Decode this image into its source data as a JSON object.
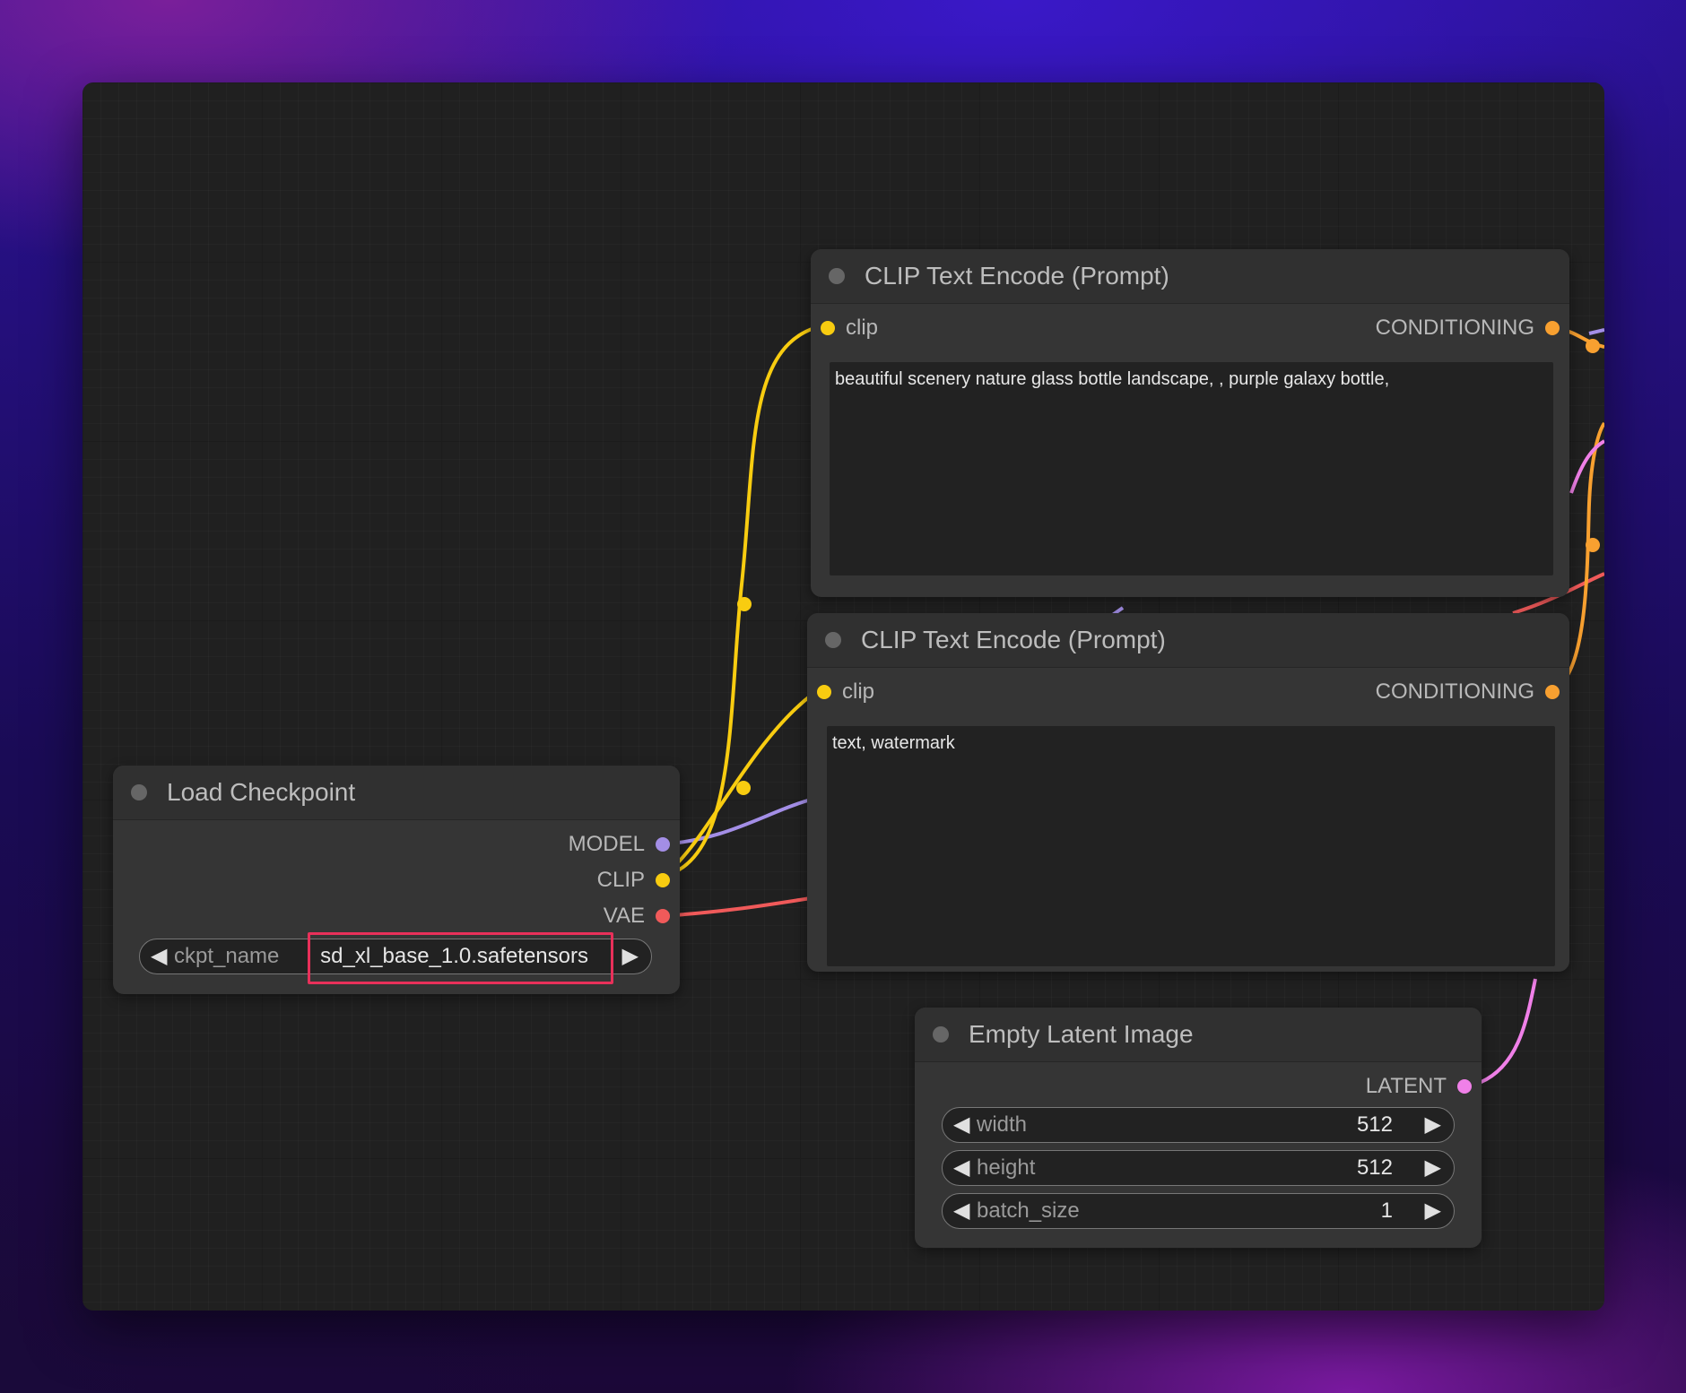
{
  "nodes": {
    "clip_top": {
      "title": "CLIP Text Encode (Prompt)",
      "input_label": "clip",
      "output_label": "CONDITIONING",
      "text": "beautiful scenery nature glass bottle landscape, , purple galaxy bottle,"
    },
    "clip_bottom": {
      "title": "CLIP Text Encode (Prompt)",
      "input_label": "clip",
      "output_label": "CONDITIONING",
      "text": "text, watermark"
    },
    "load_checkpoint": {
      "title": "Load Checkpoint",
      "outputs": [
        "MODEL",
        "CLIP",
        "VAE"
      ],
      "widget": {
        "name": "ckpt_name",
        "value": "sd_xl_base_1.0.safetensors"
      }
    },
    "empty_latent": {
      "title": "Empty Latent Image",
      "output_label": "LATENT",
      "widgets": [
        {
          "name": "width",
          "value": "512"
        },
        {
          "name": "height",
          "value": "512"
        },
        {
          "name": "batch_size",
          "value": "1"
        }
      ]
    }
  },
  "icons": {
    "arrow_left": "◀",
    "arrow_right": "▶"
  },
  "colors": {
    "model": "#a38ee6",
    "clip": "#f8cc10",
    "vae": "#f05a5a",
    "conditioning": "#f8a030",
    "latent": "#f080e8",
    "highlight": "#e8305a"
  }
}
